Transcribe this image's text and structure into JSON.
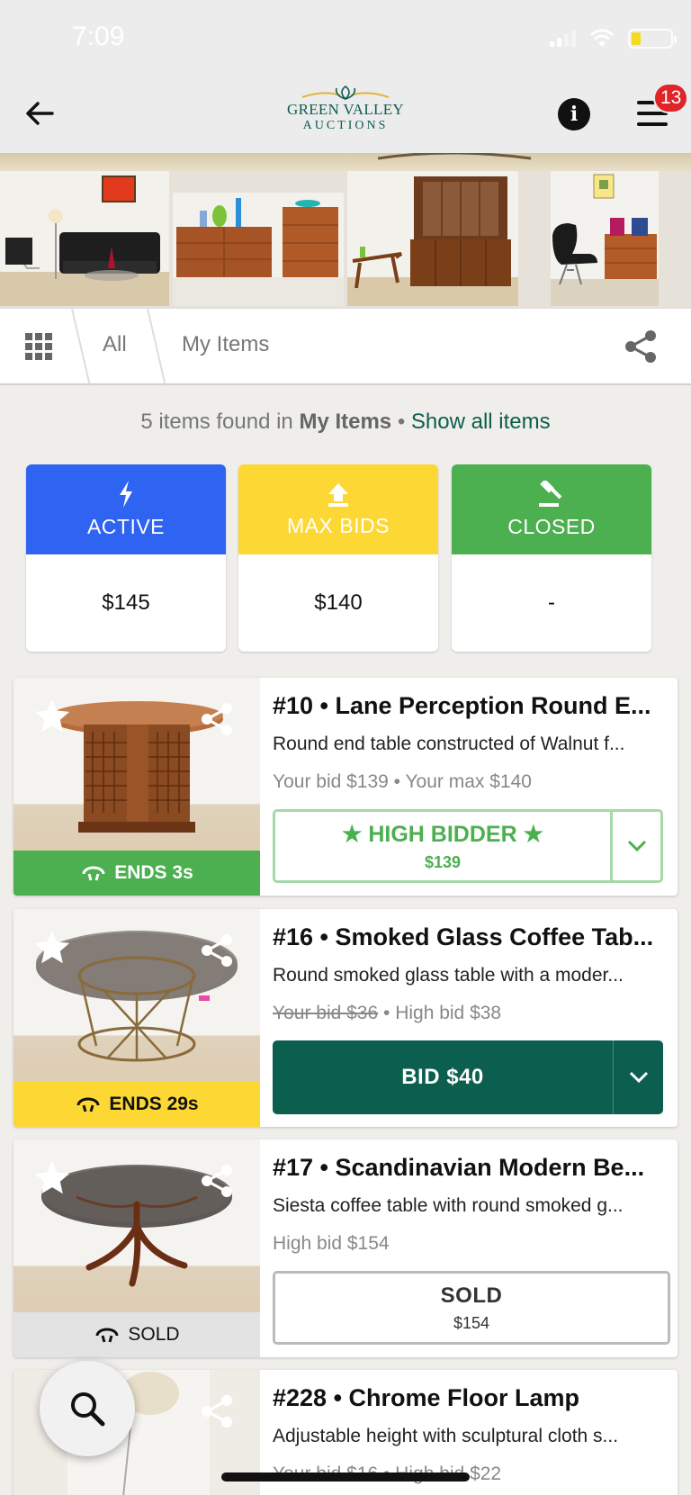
{
  "status": {
    "time": "7:09"
  },
  "header": {
    "logo_line1": "GREEN VALLEY",
    "logo_line2": "AUCTIONS",
    "notifications": "13"
  },
  "tabs": {
    "all": "All",
    "my_items": "My Items"
  },
  "summary": {
    "prefix": "5 items found in",
    "scope": "My Items",
    "separator": "•",
    "link": "Show all items"
  },
  "stats": [
    {
      "label": "ACTIVE",
      "value": "$145",
      "color": "#2f63f2"
    },
    {
      "label": "MAX BIDS",
      "value": "$140",
      "color": "#fdd835"
    },
    {
      "label": "CLOSED",
      "value": "-",
      "color": "#4caf50"
    }
  ],
  "items": [
    {
      "title": "#10 • Lane Perception Round E...",
      "desc": "Round end table constructed of Walnut f...",
      "bid_line": "Your bid $139 • Your max $140",
      "ends": "ENDS 3s",
      "action_label": "★ HIGH BIDDER ★",
      "action_sub": "$139"
    },
    {
      "title": "#16 • Smoked Glass Coffee Tab...",
      "desc": "Round smoked glass table with a moder...",
      "bid_struck": "Your bid $36",
      "bid_rest": " • High bid $38",
      "ends": "ENDS 29s",
      "action_label": "BID $40"
    },
    {
      "title": "#17 • Scandinavian Modern Be...",
      "desc": "Siesta coffee table with round smoked g...",
      "bid_line": "High bid $154",
      "ends": "SOLD",
      "action_label": "SOLD",
      "action_sub": "$154"
    },
    {
      "title": "#228 • Chrome Floor Lamp",
      "desc": "Adjustable height with sculptural cloth s...",
      "bid_line": "Your bid $16 • High bid $22"
    }
  ],
  "colors": {
    "brand": "#0c5e4e",
    "green": "#4caf50",
    "yellow": "#fdd835",
    "blue": "#2f63f2",
    "badge": "#e02428"
  }
}
